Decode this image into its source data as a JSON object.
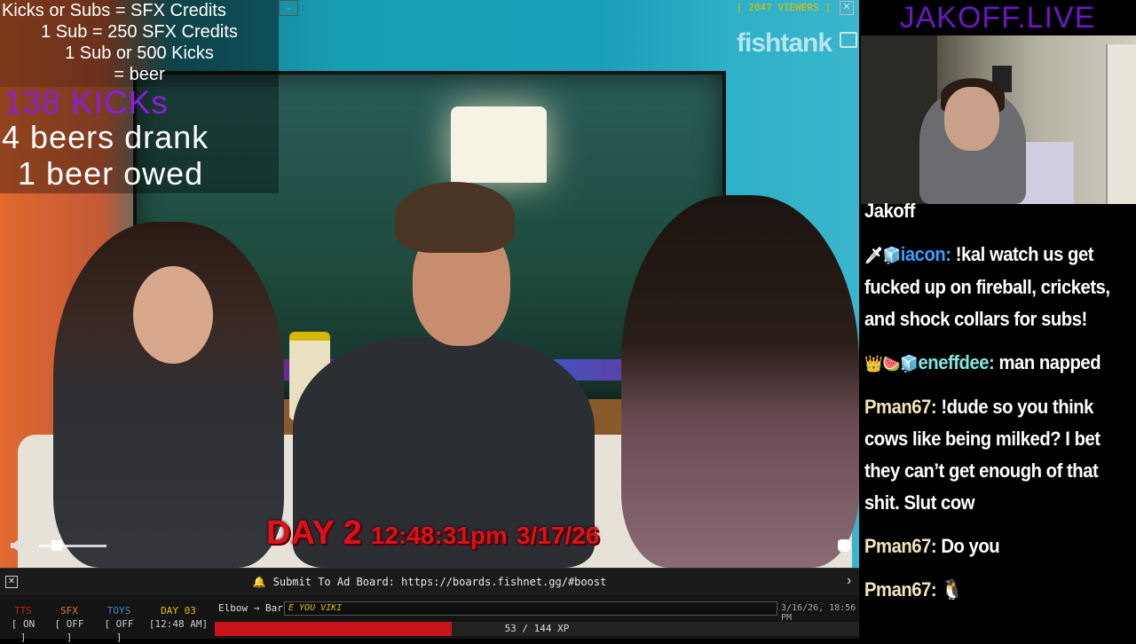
{
  "overlay": {
    "title": "Kicks or Subs = SFX Credits",
    "line1": "1 Sub = 250 SFX Credits",
    "line2": "1 Sub or 500 Kicks",
    "line3": "= beer",
    "kicks": "138 KICKs",
    "beers": "4 beers drank",
    "owed": "1 beer owed"
  },
  "stream": {
    "viewers": "[ 2047 VIEWERS ]",
    "logo": "fishtank",
    "day": "DAY 2",
    "time": "12:48:31pm",
    "date": "3/17/26"
  },
  "adbar": {
    "message": "Submit To Ad Board: https://boards.fishnet.gg/#boost"
  },
  "status": {
    "toggles": [
      {
        "label": "TTS",
        "value": "[ ON ]"
      },
      {
        "label": "SFX",
        "value": "[ OFF ]"
      },
      {
        "label": "TOYS",
        "value": "[ OFF ]"
      },
      {
        "label": "DAY 03",
        "value": "[12:48 AM]"
      }
    ],
    "route_from": "Elbow",
    "route_to": "Bar",
    "chat_text": "E YOU VIKI",
    "timestamp": "3/16/26, 18:56 PM",
    "xp_text": "53 / 144 XP",
    "xp_fraction": 0.368
  },
  "right": {
    "brand": "JAKOFF.LIVE"
  },
  "chat": [
    {
      "badges": "",
      "user": "",
      "text": "Jakoff",
      "cls": "cut"
    },
    {
      "badges": "🗡🧊",
      "user": "iacon:",
      "text": "!kal watch us get fucked up on fireball, crickets, and shock collars for subs!",
      "ucls": "u-iacon"
    },
    {
      "badges": "👑🍉🧊",
      "user": "eneffdee:",
      "text": "man napped",
      "ucls": "u-eneff"
    },
    {
      "badges": "",
      "user": "Pman67:",
      "text": "!dude so you think cows like being milked? I bet they can’t get enough of that shit. Slut cow",
      "ucls": "u-pman"
    },
    {
      "badges": "",
      "user": "Pman67:",
      "text": "Do you",
      "ucls": "u-pman"
    },
    {
      "badges": "",
      "user": "Pman67:",
      "text": "🐧",
      "ucls": "u-pman"
    }
  ],
  "colors": {
    "accent_purple": "#6b18c2",
    "kicks_purple": "#8a1fd6",
    "xp_red": "#c8141a",
    "viewer_yellow": "#e7c000"
  }
}
